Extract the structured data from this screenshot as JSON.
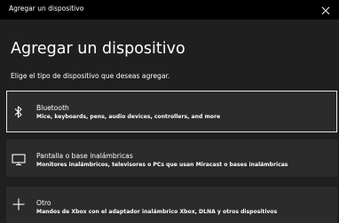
{
  "window": {
    "title": "Agregar un dispositivo"
  },
  "dialog": {
    "heading": "Agregar un dispositivo",
    "subtitle": "Elige el tipo de dispositivo que deseas agregar."
  },
  "options": [
    {
      "label": "Bluetooth",
      "description": "Mice, keyboards, pens, audio devices, controllers, and more",
      "icon": "bluetooth-icon",
      "selected": true
    },
    {
      "label": "Pantalla o base inalámbricas",
      "description": "Monitores inalámbricos, televisores o PCs que usan Miracast o bases inalámbricas",
      "icon": "monitor-icon",
      "selected": false
    },
    {
      "label": "Otro",
      "description": "Mandos de Xbox con el adaptador inalámbrico Xbox, DLNA y otros dispositivos",
      "icon": "plus-icon",
      "selected": false
    }
  ],
  "colors": {
    "background": "#1f1f1f",
    "titlebar": "#000000",
    "card": "#2b2b2b",
    "focus_border": "#e6e6e6",
    "text": "#ffffff"
  }
}
